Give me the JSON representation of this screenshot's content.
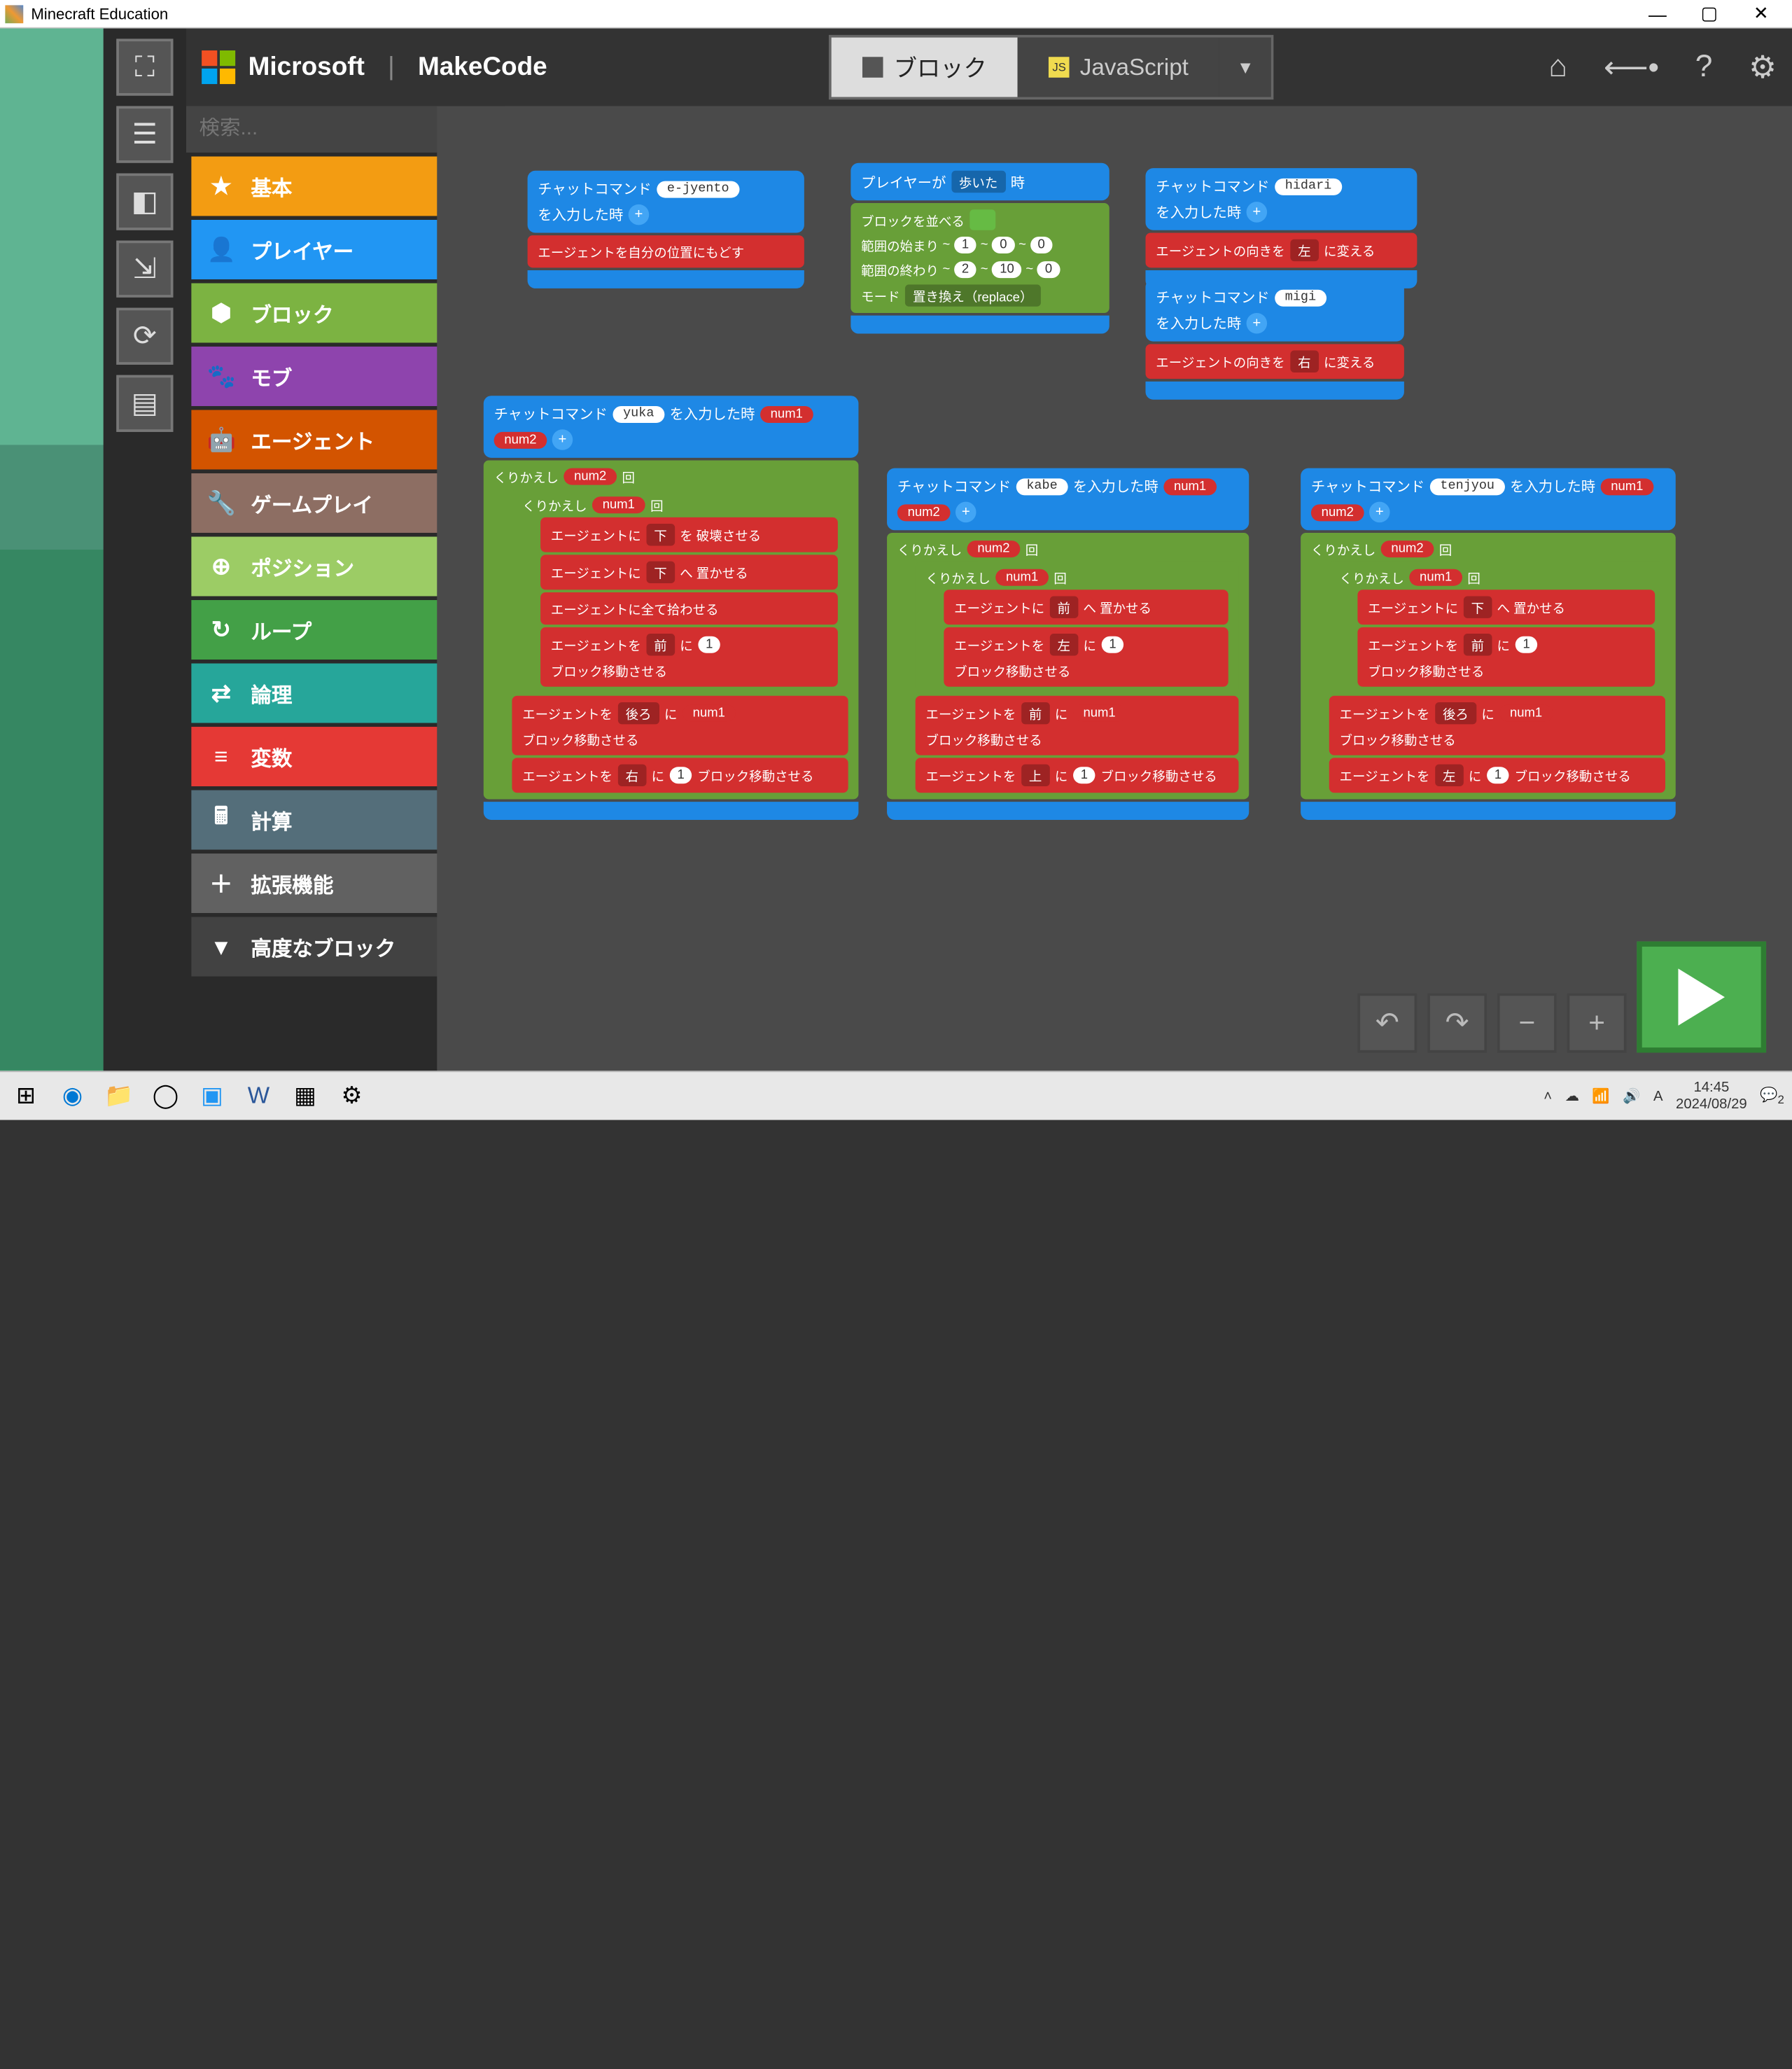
{
  "window": {
    "title": "Minecraft Education"
  },
  "header": {
    "brand1": "Microsoft",
    "brand2": "MakeCode",
    "tab_blocks": "ブロック",
    "tab_js": "JavaScript"
  },
  "search": {
    "placeholder": "検索..."
  },
  "toolbox": [
    {
      "label": "基本",
      "color": "#f39c12",
      "icon": "★"
    },
    {
      "label": "プレイヤー",
      "color": "#2196f3",
      "icon": "👤"
    },
    {
      "label": "ブロック",
      "color": "#7cb342",
      "icon": "⬢"
    },
    {
      "label": "モブ",
      "color": "#8e44ad",
      "icon": "🐾"
    },
    {
      "label": "エージェント",
      "color": "#d35400",
      "icon": "🤖"
    },
    {
      "label": "ゲームプレイ",
      "color": "#8d6e63",
      "icon": "🔧"
    },
    {
      "label": "ポジション",
      "color": "#9ccc65",
      "icon": "⊕"
    },
    {
      "label": "ループ",
      "color": "#43a047",
      "icon": "↻"
    },
    {
      "label": "論理",
      "color": "#26a69a",
      "icon": "⇄"
    },
    {
      "label": "変数",
      "color": "#e53935",
      "icon": "≡"
    },
    {
      "label": "計算",
      "color": "#546e7a",
      "icon": "🖩"
    },
    {
      "label": "拡張機能",
      "color": "#616161",
      "icon": "＋"
    },
    {
      "label": "高度なブロック",
      "color": "#424242",
      "icon": "▾"
    }
  ],
  "ws": {
    "chat_cmd": "チャットコマンド",
    "on_input": "を入力した時",
    "agent_return": "エージェントを自分の位置にもどす",
    "player_when": "プレイヤーが",
    "walked": "歩いた",
    "when": "時",
    "fill_blocks": "ブロックを並べる",
    "range_from": "範囲の始まり",
    "range_to": "範囲の終わり",
    "mode": "モード",
    "replace": "置き換え（replace）",
    "agent_turn": "エージェントの向きを",
    "change": "に変える",
    "left": "左",
    "right": "右",
    "repeat": "くりかえし",
    "times": "回",
    "agent_ni": "エージェントに",
    "destroy": "を 破壊させる",
    "place": "へ 置かせる",
    "collect_all": "エージェントに全て拾わせる",
    "agent_wo": "エージェントを",
    "move": "ブロック移動させる",
    "ni": "に",
    "down": "下",
    "up": "上",
    "fwd": "前",
    "back": "後ろ",
    "cmd_ejyento": "e-jyento",
    "cmd_hidari": "hidari",
    "cmd_migi": "migi",
    "cmd_yuka": "yuka",
    "cmd_kabe": "kabe",
    "cmd_tenjyou": "tenjyou",
    "num1": "num1",
    "num2": "num2",
    "v0": "0",
    "v1": "1",
    "v2": "2",
    "v10": "10"
  },
  "tray": {
    "ime": "A",
    "time": "14:45",
    "date": "2024/08/29",
    "notif": "2"
  }
}
